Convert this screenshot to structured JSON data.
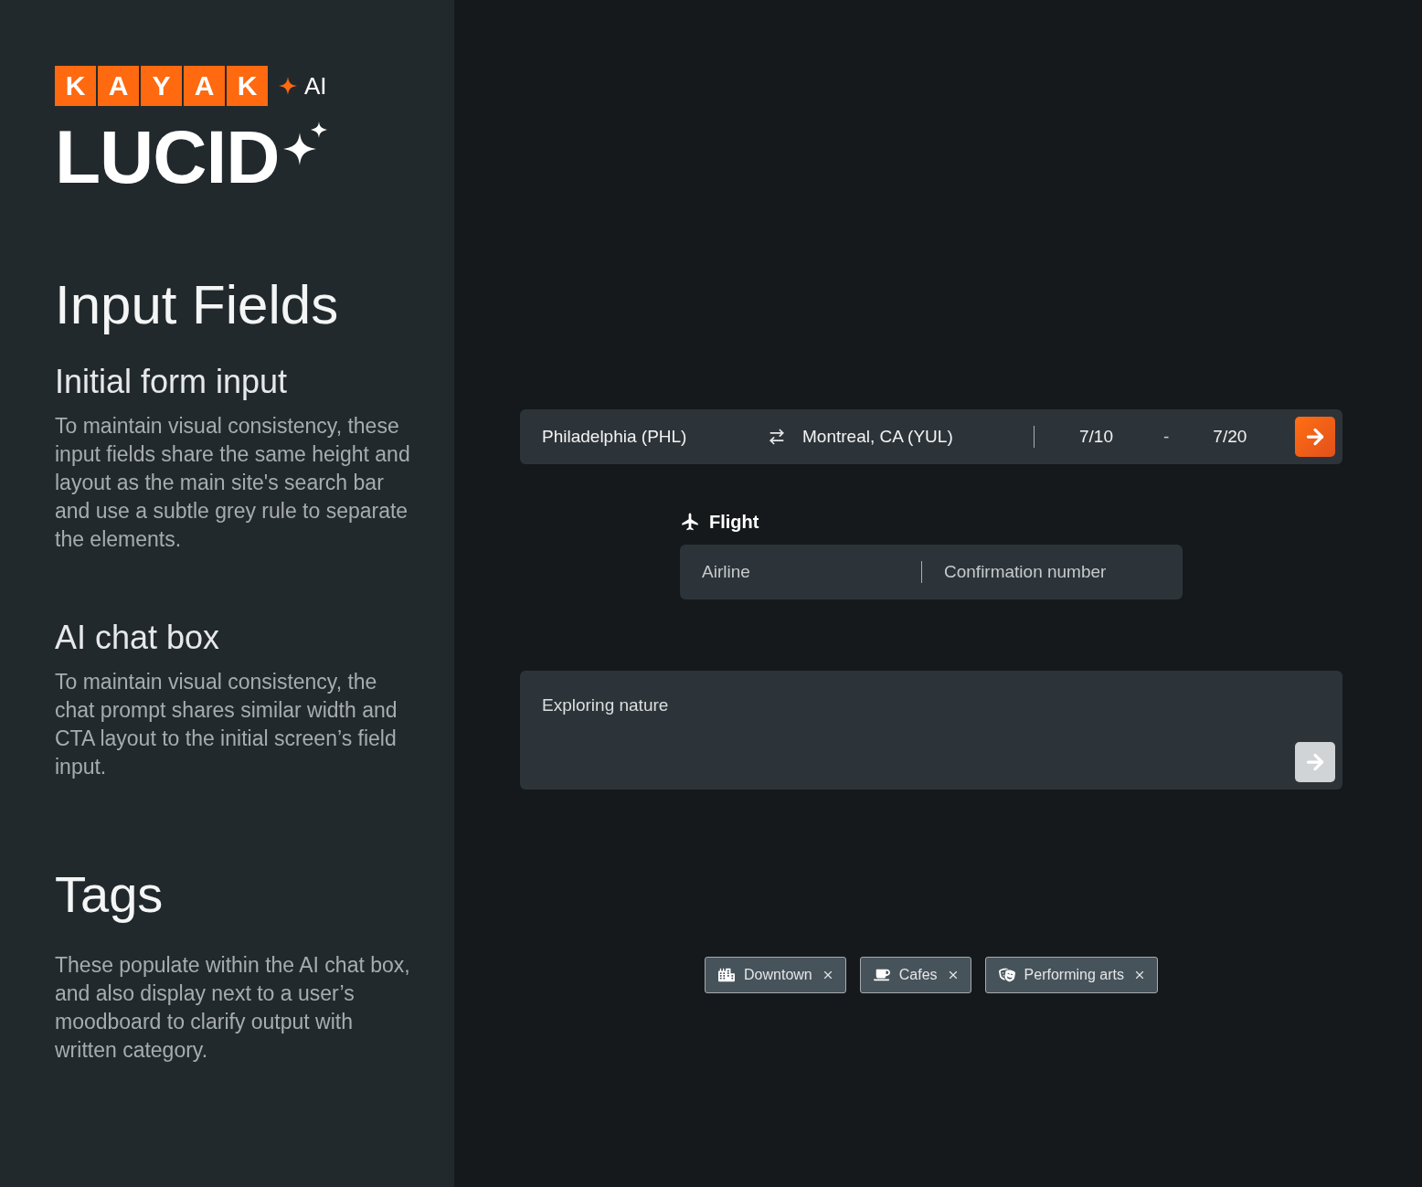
{
  "sidebar": {
    "logo": {
      "letters": [
        "K",
        "A",
        "Y",
        "A",
        "K"
      ],
      "badge": "AI"
    },
    "product": "LUCID",
    "title": "Input Fields",
    "sections": [
      {
        "heading": "Initial form input",
        "body": "To maintain visual consistency, these input fields share the same height and layout as the main site's search bar and use a subtle grey rule to separate the elements."
      },
      {
        "heading": "AI chat box",
        "body": "To maintain visual consistency, the chat prompt shares similar width and CTA layout to the initial screen’s field input."
      }
    ],
    "tags_section": {
      "heading": "Tags",
      "body": "These populate within the AI chat box, and also display next to a user’s moodboard to clarify output with written category."
    }
  },
  "search_bar": {
    "origin": "Philadelphia (PHL)",
    "destination": "Montreal, CA (YUL)",
    "depart": "7/10",
    "separator": "-",
    "return": "7/20"
  },
  "flight_form": {
    "label": "Flight",
    "airline": {
      "placeholder": "Airline"
    },
    "confirmation": {
      "placeholder": "Confirmation number"
    }
  },
  "chat_box": {
    "placeholder": "Exploring nature",
    "send_disabled": true
  },
  "tags": [
    {
      "label": "Downtown",
      "kind": "city"
    },
    {
      "label": "Cafes",
      "kind": "cafe"
    },
    {
      "label": "Performing arts",
      "kind": "theater"
    }
  ]
}
